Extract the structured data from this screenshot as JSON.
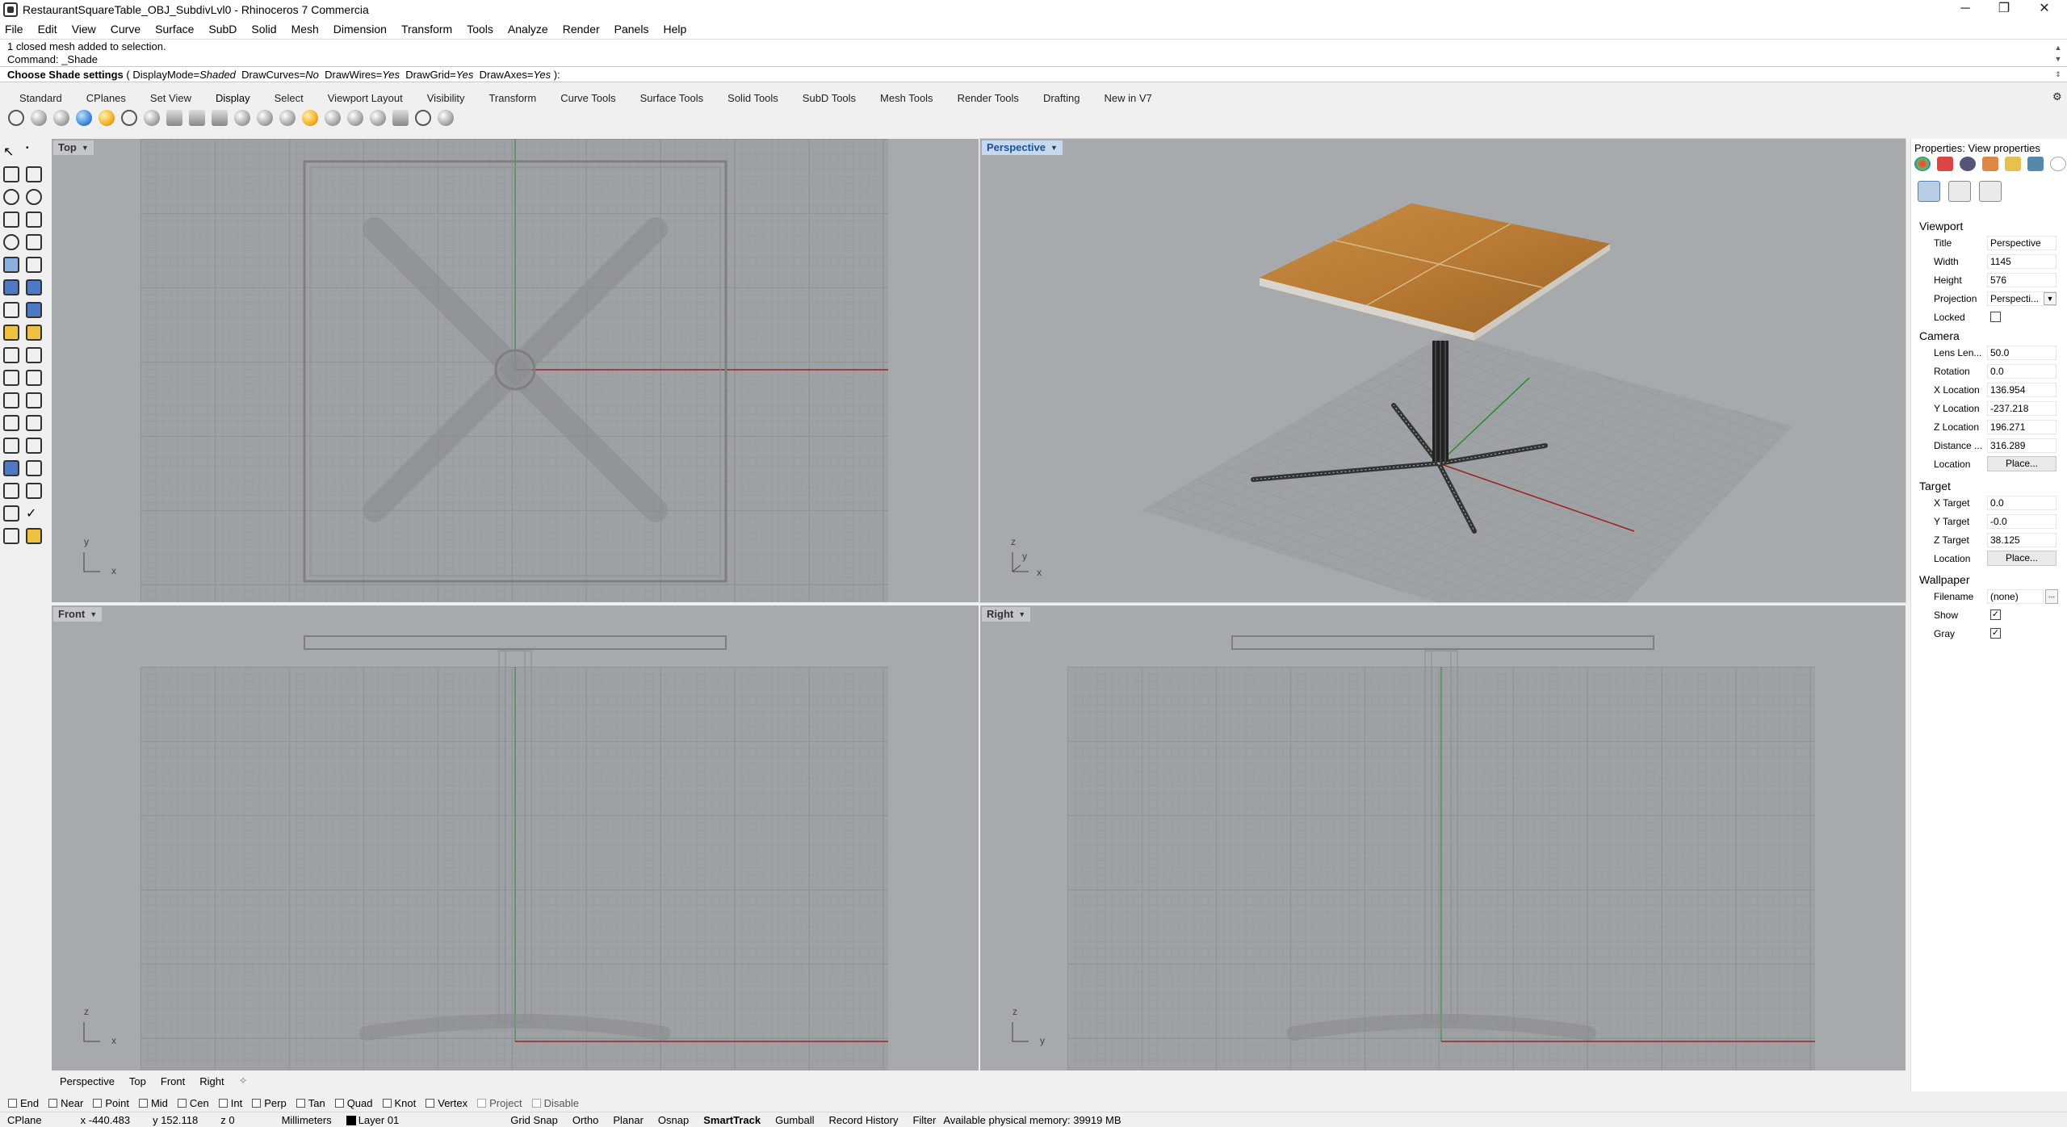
{
  "window": {
    "title": "RestaurantSquareTable_OBJ_SubdivLvl0 - Rhinoceros 7 Commercia",
    "minimize": "─",
    "maximize": "❐",
    "close": "✕"
  },
  "menu": [
    "File",
    "Edit",
    "View",
    "Curve",
    "Surface",
    "SubD",
    "Solid",
    "Mesh",
    "Dimension",
    "Transform",
    "Tools",
    "Analyze",
    "Render",
    "Panels",
    "Help"
  ],
  "command": {
    "history": [
      "1 closed mesh added to selection.",
      "Command: _Shade"
    ],
    "prompt_label": "Choose Shade settings",
    "prompt_open": "( ",
    "opt1_name": "DisplayMode=",
    "opt1_val": "Shaded",
    "opt2_name": "DrawCurves=",
    "opt2_val": "No",
    "opt3_name": "DrawWires=",
    "opt3_val": "Yes",
    "opt4_name": "DrawGrid=",
    "opt4_val": "Yes",
    "opt5_name": "DrawAxes=",
    "opt5_val": "Yes",
    "prompt_close": " ):"
  },
  "toolbar_tabs": [
    "Standard",
    "CPlanes",
    "Set View",
    "Display",
    "Select",
    "Viewport Layout",
    "Visibility",
    "Transform",
    "Curve Tools",
    "Surface Tools",
    "Solid Tools",
    "SubD Tools",
    "Mesh Tools",
    "Render Tools",
    "Drafting",
    "New in V7"
  ],
  "viewports": {
    "top": {
      "label": "Top",
      "axis1": "y",
      "axis2": "x"
    },
    "perspective": {
      "label": "Perspective",
      "axis1": "z",
      "axis2": "y",
      "axis3": "x"
    },
    "front": {
      "label": "Front",
      "axis1": "z",
      "axis2": "x"
    },
    "right": {
      "label": "Right",
      "axis1": "z",
      "axis2": "y"
    }
  },
  "view_tabs": [
    "Perspective",
    "Top",
    "Front",
    "Right"
  ],
  "view_tab_add": "✧",
  "osnaps": [
    {
      "label": "End",
      "checked": false
    },
    {
      "label": "Near",
      "checked": false
    },
    {
      "label": "Point",
      "checked": false
    },
    {
      "label": "Mid",
      "checked": false
    },
    {
      "label": "Cen",
      "checked": false
    },
    {
      "label": "Int",
      "checked": false
    },
    {
      "label": "Perp",
      "checked": false
    },
    {
      "label": "Tan",
      "checked": false
    },
    {
      "label": "Quad",
      "checked": false
    },
    {
      "label": "Knot",
      "checked": false
    },
    {
      "label": "Vertex",
      "checked": false
    },
    {
      "label": "Project",
      "checked": false,
      "disabled": true
    },
    {
      "label": "Disable",
      "checked": false,
      "disabled": true
    }
  ],
  "status": {
    "cplane": "CPlane",
    "x": "x -440.483",
    "y": "y 152.118",
    "z": "z 0",
    "units": "Millimeters",
    "layer": "Layer 01",
    "grid_snap": "Grid Snap",
    "ortho": "Ortho",
    "planar": "Planar",
    "osnap": "Osnap",
    "smarttrack": "SmartTrack",
    "gumball": "Gumball",
    "record_history": "Record History",
    "filter": "Filter",
    "memory": "Available physical memory: 39919 MB"
  },
  "panel": {
    "title": "Properties: View properties",
    "viewport_section": "Viewport",
    "title_label": "Title",
    "title_value": "Perspective",
    "width_label": "Width",
    "width_value": "1145",
    "height_label": "Height",
    "height_value": "576",
    "projection_label": "Projection",
    "projection_value": "Perspecti...",
    "locked_label": "Locked",
    "camera_section": "Camera",
    "lens_label": "Lens Len...",
    "lens_value": "50.0",
    "rotation_label": "Rotation",
    "rotation_value": "0.0",
    "xloc_label": "X Location",
    "xloc_value": "136.954",
    "yloc_label": "Y Location",
    "yloc_value": "-237.218",
    "zloc_label": "Z Location",
    "zloc_value": "196.271",
    "dist_label": "Distance ...",
    "dist_value": "316.289",
    "loc_label": "Location",
    "loc_btn": "Place...",
    "target_section": "Target",
    "xt_label": "X Target",
    "xt_value": "0.0",
    "yt_label": "Y Target",
    "yt_value": "-0.0",
    "zt_label": "Z Target",
    "zt_value": "38.125",
    "tloc_label": "Location",
    "tloc_btn": "Place...",
    "wallpaper_section": "Wallpaper",
    "filename_label": "Filename",
    "filename_value": "(none)",
    "filename_btn": "...",
    "show_label": "Show",
    "gray_label": "Gray",
    "check_mark": "✓"
  }
}
